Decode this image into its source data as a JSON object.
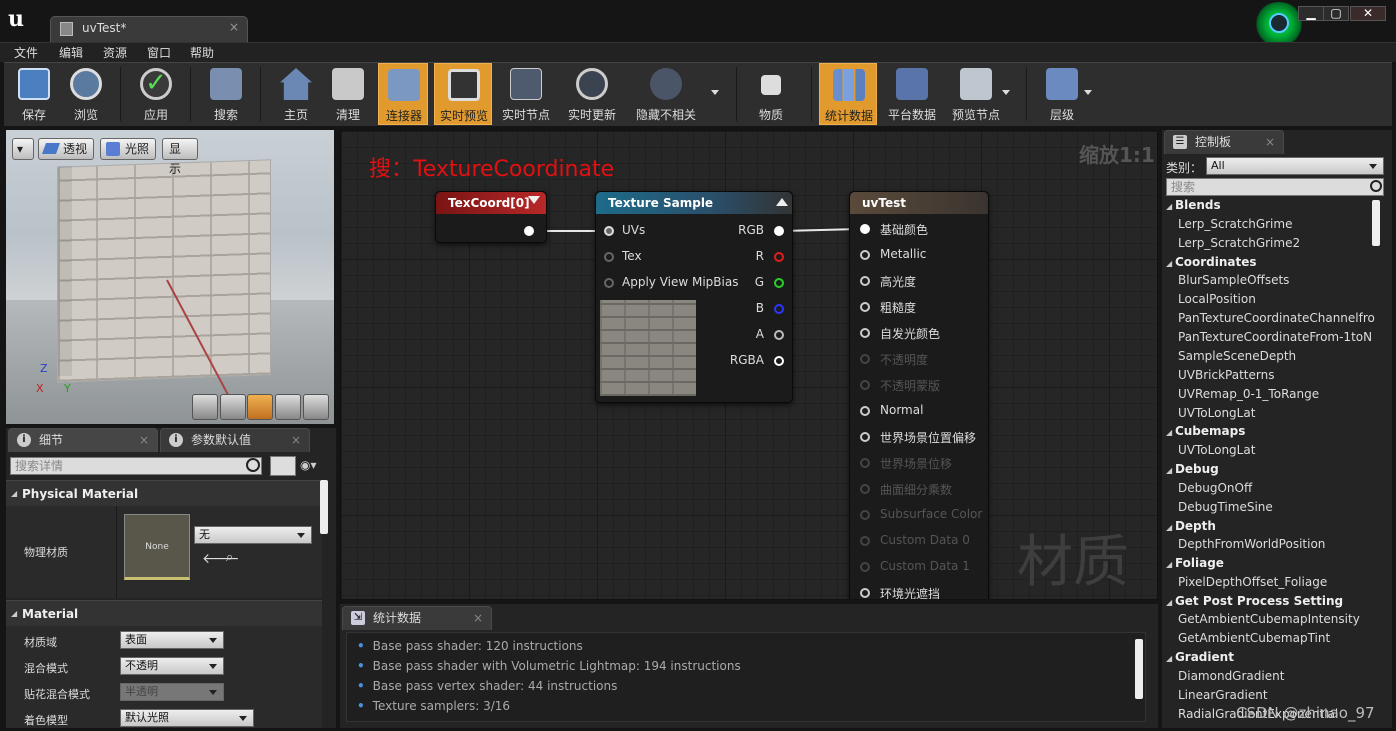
{
  "window": {
    "document_tab": "uvTest*",
    "tab_close": "×",
    "min": "▁",
    "max": "▢",
    "close": "✕"
  },
  "menu": [
    "文件",
    "编辑",
    "资源",
    "窗口",
    "帮助"
  ],
  "toolbar": {
    "buttons": [
      {
        "label": "保存",
        "icon": "save-icon",
        "active": false
      },
      {
        "label": "浏览",
        "icon": "browse-icon",
        "active": false
      },
      {
        "label": "应用",
        "icon": "apply-icon",
        "active": false
      },
      {
        "label": "搜索",
        "icon": "search-icon",
        "active": false
      },
      {
        "label": "主页",
        "icon": "home-icon",
        "active": false
      },
      {
        "label": "清理",
        "icon": "clean-icon",
        "active": false
      },
      {
        "label": "连接器",
        "icon": "connectors-icon",
        "active": true
      },
      {
        "label": "实时预览",
        "icon": "live-preview-icon",
        "active": true
      },
      {
        "label": "实时节点",
        "icon": "live-nodes-icon",
        "active": false
      },
      {
        "label": "实时更新",
        "icon": "live-update-icon",
        "active": false
      },
      {
        "label": "隐藏不相关",
        "icon": "hide-unrelated-icon",
        "active": false
      },
      {
        "label": "物质",
        "icon": "substance-icon",
        "active": false
      },
      {
        "label": "统计数据",
        "icon": "stats-icon",
        "active": true
      },
      {
        "label": "平台数据",
        "icon": "platform-stats-icon",
        "active": false
      },
      {
        "label": "预览节点",
        "icon": "preview-node-icon",
        "active": false
      },
      {
        "label": "层级",
        "icon": "hierarchy-icon",
        "active": false
      }
    ]
  },
  "viewport": {
    "dropdown": "▾",
    "perspective": "透视",
    "lit": "光照",
    "show": "显示",
    "axis_z": "Z",
    "axis_x": "X",
    "axis_y": "Y"
  },
  "details": {
    "tab_details": "细节",
    "tab_defaults": "参数默认值",
    "search_placeholder": "搜索详情",
    "section_physical": "Physical Material",
    "phys_label": "物理材质",
    "phys_thumb": "None",
    "phys_value": "无",
    "section_material": "Material",
    "props": [
      {
        "label": "材质域",
        "value": "表面",
        "enabled": true
      },
      {
        "label": "混合模式",
        "value": "不透明",
        "enabled": true
      },
      {
        "label": "贴花混合模式",
        "value": "半透明",
        "enabled": false
      },
      {
        "label": "着色模型",
        "value": "默认光照",
        "enabled": true
      }
    ]
  },
  "graph": {
    "zoom": "缩放1:1",
    "search_hint": "搜：TextureCoordinate",
    "watermark": "材质",
    "texcoord": {
      "title": "TexCoord[0]"
    },
    "texture_sample": {
      "title": "Texture Sample",
      "inputs": [
        "UVs",
        "Tex",
        "Apply View MipBias"
      ],
      "outputs": [
        "RGB",
        "R",
        "G",
        "B",
        "A",
        "RGBA"
      ],
      "output_colors": [
        "#ffffff",
        "#e01c1c",
        "#26d126",
        "#2c36ff",
        "#bbbbbb",
        "#ffffff"
      ]
    },
    "result": {
      "title": "uvTest",
      "inputs": [
        {
          "label": "基础颜色",
          "enabled": true,
          "connected": true
        },
        {
          "label": "Metallic",
          "enabled": true,
          "connected": false
        },
        {
          "label": "高光度",
          "enabled": true,
          "connected": false
        },
        {
          "label": "粗糙度",
          "enabled": true,
          "connected": false
        },
        {
          "label": "自发光颜色",
          "enabled": true,
          "connected": false
        },
        {
          "label": "不透明度",
          "enabled": false,
          "connected": false
        },
        {
          "label": "不透明蒙版",
          "enabled": false,
          "connected": false
        },
        {
          "label": "Normal",
          "enabled": true,
          "connected": false
        },
        {
          "label": "世界场景位置偏移",
          "enabled": true,
          "connected": false
        },
        {
          "label": "世界场景位移",
          "enabled": false,
          "connected": false
        },
        {
          "label": "曲面细分乘数",
          "enabled": false,
          "connected": false
        },
        {
          "label": "Subsurface Color",
          "enabled": false,
          "connected": false
        },
        {
          "label": "Custom Data 0",
          "enabled": false,
          "connected": false
        },
        {
          "label": "Custom Data 1",
          "enabled": false,
          "connected": false
        },
        {
          "label": "环境光遮挡",
          "enabled": true,
          "connected": false
        }
      ]
    }
  },
  "stats": {
    "tab": "统计数据",
    "lines": [
      "Base pass shader: 120 instructions",
      "Base pass shader with Volumetric Lightmap: 194 instructions",
      "Base pass vertex shader: 44 instructions",
      "Texture samplers: 3/16"
    ]
  },
  "palette": {
    "tab": "控制板",
    "category_label": "类别：",
    "category_value": "All",
    "search_placeholder": "搜索",
    "groups": [
      {
        "name": "Blends",
        "items": [
          "Lerp_ScratchGrime",
          "Lerp_ScratchGrime2"
        ]
      },
      {
        "name": "Coordinates",
        "items": [
          "BlurSampleOffsets",
          "LocalPosition",
          "PanTextureCoordinateChannelfro",
          "PanTextureCoordinateFrom-1toN",
          "SampleSceneDepth",
          "UVBrickPatterns",
          "UVRemap_0-1_ToRange",
          "UVToLongLat"
        ]
      },
      {
        "name": "Cubemaps",
        "items": [
          "UVToLongLat"
        ]
      },
      {
        "name": "Debug",
        "items": [
          "DebugOnOff",
          "DebugTimeSine"
        ]
      },
      {
        "name": "Depth",
        "items": [
          "DepthFromWorldPosition"
        ]
      },
      {
        "name": "Foliage",
        "items": [
          "PixelDepthOffset_Foliage"
        ]
      },
      {
        "name": "Get Post Process Setting",
        "items": [
          "GetAmbientCubemapIntensity",
          "GetAmbientCubemapTint"
        ]
      },
      {
        "name": "Gradient",
        "items": [
          "DiamondGradient",
          "LinearGradient",
          "RadialGradientExponential"
        ]
      }
    ]
  },
  "footer_watermark": "CSDN @zhinao_97"
}
